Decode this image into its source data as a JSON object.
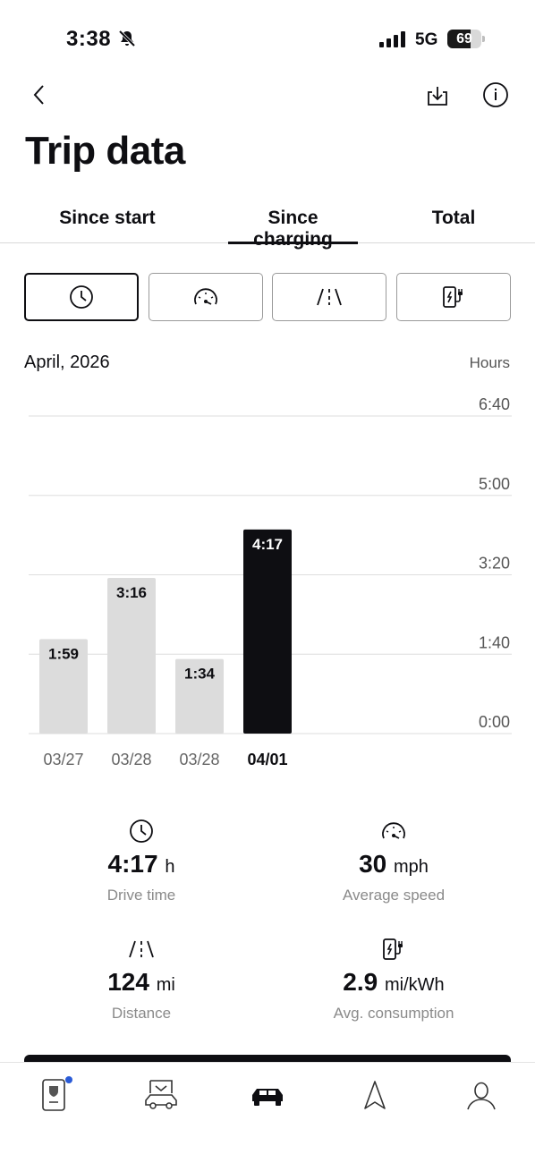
{
  "status": {
    "time": "3:38",
    "network": "5G",
    "battery": "69",
    "battery_level": 0.69
  },
  "header": {
    "title": "Trip data"
  },
  "tabs": [
    {
      "label": "Since start",
      "active": false
    },
    {
      "label": "Since charging",
      "active": true
    },
    {
      "label": "Total",
      "active": false
    }
  ],
  "metrics": [
    {
      "icon": "clock-icon",
      "selected": true
    },
    {
      "icon": "speedometer-icon",
      "selected": false
    },
    {
      "icon": "road-icon",
      "selected": false
    },
    {
      "icon": "charging-station-icon",
      "selected": false
    }
  ],
  "chart_header": {
    "period": "April, 2026",
    "unit": "Hours"
  },
  "chart_data": {
    "type": "bar",
    "categories": [
      "03/27",
      "03/28",
      "03/28",
      "04/01"
    ],
    "values": [
      119,
      196,
      94,
      257
    ],
    "value_labels": [
      "1:59",
      "3:16",
      "1:34",
      "4:17"
    ],
    "highlight_index": 3,
    "ylim": [
      0,
      400
    ],
    "yticks": [
      0,
      100,
      200,
      300,
      400
    ],
    "ytick_labels": [
      "0:00",
      "1:40",
      "3:20",
      "5:00",
      "6:40"
    ],
    "ylabel": "Hours",
    "grid": true,
    "colors": {
      "bar": "#dcdcdc",
      "highlight": "#0e0e12",
      "grid": "#dedede"
    }
  },
  "stats": [
    {
      "icon": "clock-icon",
      "value": "4:17",
      "unit": "h",
      "label": "Drive time"
    },
    {
      "icon": "speedometer-icon",
      "value": "30",
      "unit": "mph",
      "label": "Average speed"
    },
    {
      "icon": "road-icon",
      "value": "124",
      "unit": "mi",
      "label": "Distance"
    },
    {
      "icon": "charging-station-icon",
      "value": "2.9",
      "unit": "mi/kWh",
      "label": "Avg. consumption"
    }
  ],
  "colors": {
    "accent": "#0e0e12",
    "muted": "#8a8a8a",
    "notification": "#2a5bd7"
  }
}
